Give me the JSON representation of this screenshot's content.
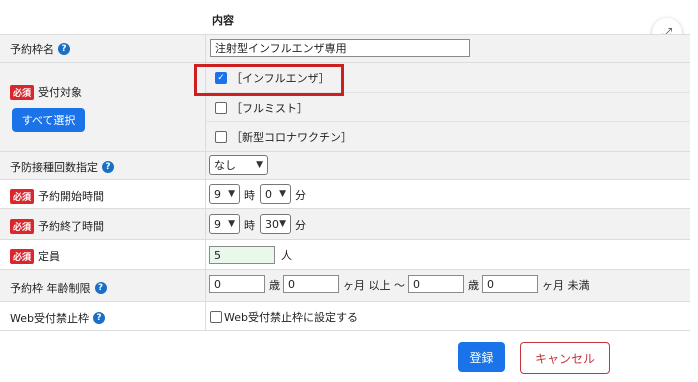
{
  "header": {
    "content_col": "内容"
  },
  "rows": {
    "slot_name": {
      "label": "予約枠名",
      "value": "注射型インフルエンザ専用"
    },
    "reception": {
      "required": "必須",
      "label": "受付対象",
      "select_all": "すべて選択",
      "options": [
        {
          "label": "［インフルエンザ］",
          "checked": true
        },
        {
          "label": "［フルミスト］",
          "checked": false
        },
        {
          "label": "［新型コロナワクチン］",
          "checked": false
        }
      ]
    },
    "dose": {
      "label": "予防接種回数指定",
      "value": "なし"
    },
    "start": {
      "required": "必須",
      "label": "予約開始時間",
      "hour": "9",
      "hour_unit": "時",
      "minute": "0",
      "minute_unit": "分"
    },
    "end": {
      "required": "必須",
      "label": "予約終了時間",
      "hour": "9",
      "hour_unit": "時",
      "minute": "30",
      "minute_unit": "分"
    },
    "capacity": {
      "required": "必須",
      "label": "定員",
      "value": "5",
      "unit": "人"
    },
    "age": {
      "label": "予約枠 年齢制限",
      "from_years": "0",
      "years1": "歳",
      "from_months": "0",
      "months1": "ヶ月 以上 〜",
      "to_years": "0",
      "years2": "歳",
      "to_months": "0",
      "months2": "ヶ月 未満"
    },
    "web": {
      "label": "Web受付禁止枠",
      "checkbox_label": "Web受付禁止枠に設定する",
      "checked": false
    }
  },
  "footer": {
    "register": "登録",
    "cancel": "キャンセル"
  },
  "colors": {
    "accent": "#1a73e8",
    "required": "#d9272e",
    "highlight": "#cc1f1f"
  },
  "icons": {
    "expand": "expand-icon",
    "help": "help-icon"
  }
}
